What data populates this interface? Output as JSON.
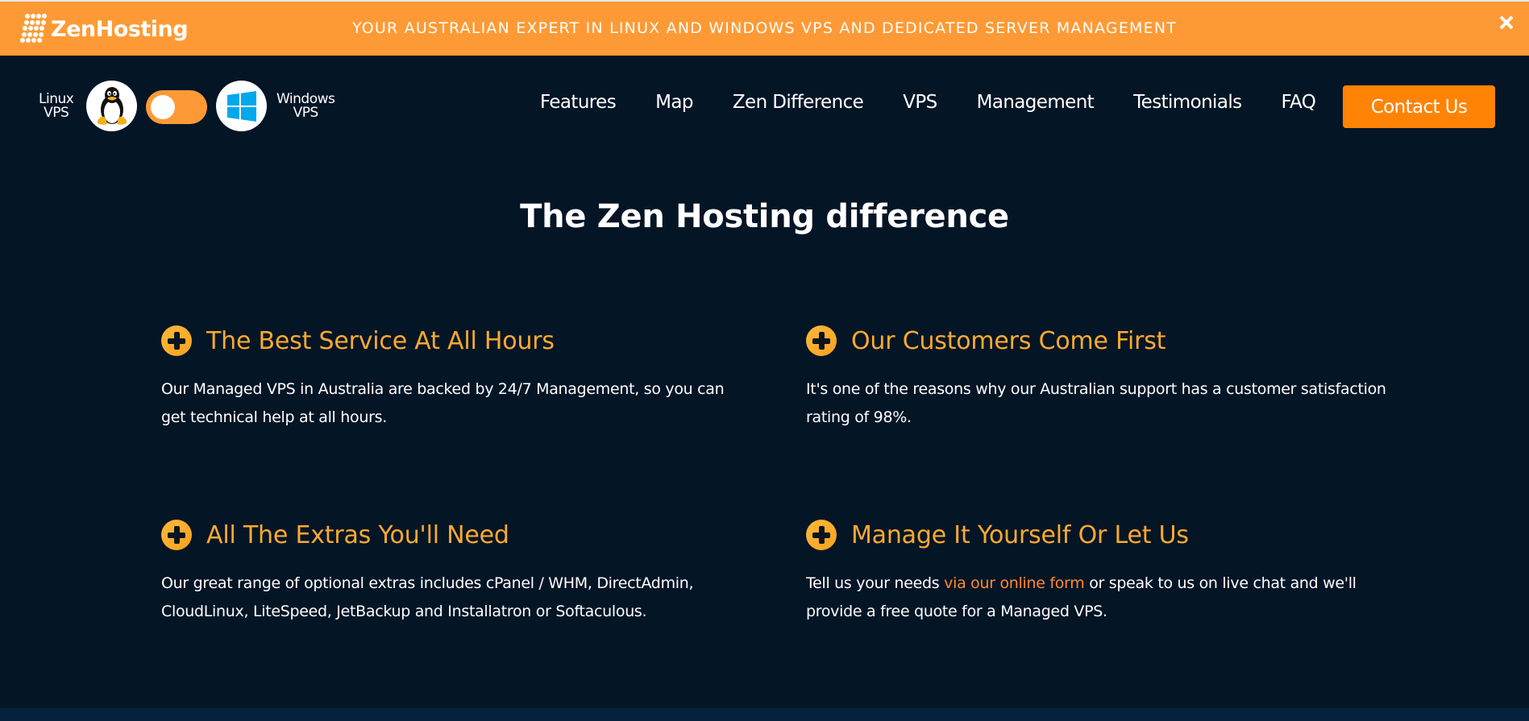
{
  "banner": {
    "brand": "ZenHosting",
    "message": "YOUR AUSTRALIAN EXPERT IN LINUX AND WINDOWS VPS AND DEDICATED SERVER MANAGEMENT",
    "close_icon": "close-icon"
  },
  "os_switch": {
    "left_label_line1": "Linux",
    "left_label_line2": "VPS",
    "right_label_line1": "Windows",
    "right_label_line2": "VPS",
    "left_icon": "linux-penguin-icon",
    "right_icon": "windows-logo-icon",
    "selected": "Linux VPS"
  },
  "nav": {
    "items": [
      {
        "label": "Features"
      },
      {
        "label": "Map"
      },
      {
        "label": "Zen Difference"
      },
      {
        "label": "VPS"
      },
      {
        "label": "Management"
      },
      {
        "label": "Testimonials"
      },
      {
        "label": "FAQ"
      }
    ],
    "contact_label": "Contact Us"
  },
  "main": {
    "title": "The Zen Hosting difference",
    "features": [
      {
        "icon": "plus-circle-icon",
        "heading": "The Best Service At All Hours",
        "text": "Our Managed VPS in Australia are backed by 24/7 Management, so you can get technical help at all hours."
      },
      {
        "icon": "plus-circle-icon",
        "heading": "Our Customers Come First",
        "text": "It's one of the reasons why our Australian support has a customer satisfaction rating of 98%."
      },
      {
        "icon": "plus-circle-icon",
        "heading": "All The Extras You'll Need",
        "text": "Our great range of optional extras includes cPanel / WHM, DirectAdmin, CloudLinux, LiteSpeed, JetBackup and Installatron or Softaculous."
      },
      {
        "icon": "plus-circle-icon",
        "heading": "Manage It Yourself Or Let Us",
        "text_before": "Tell us your needs ",
        "link_text": "via our online form",
        "text_after": " or speak to us on live chat and we'll provide a free quote for a Managed VPS."
      }
    ]
  },
  "colors": {
    "banner_bg": "#fe9a35",
    "page_bg": "#041526",
    "accent_heading": "#fbaa2f",
    "contact_button": "#ff8304",
    "link": "#ff8a2a",
    "footer_strip": "#06213e"
  }
}
